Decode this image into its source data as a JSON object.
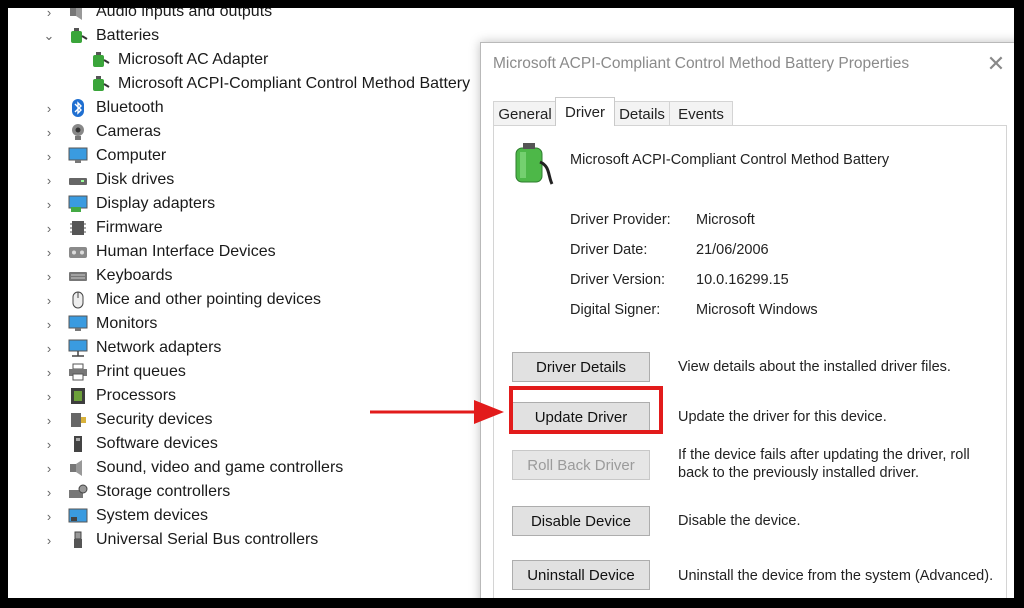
{
  "tree": [
    {
      "label": "Audio inputs and outputs",
      "expanded": false,
      "icon": "speaker-icon"
    },
    {
      "label": "Batteries",
      "expanded": true,
      "icon": "battery-icon"
    },
    {
      "label": "Microsoft AC Adapter",
      "child": true,
      "icon": "battery-icon"
    },
    {
      "label": "Microsoft ACPI-Compliant Control Method Battery",
      "child": true,
      "icon": "battery-icon"
    },
    {
      "label": "Bluetooth",
      "expanded": false,
      "icon": "bluetooth-icon"
    },
    {
      "label": "Cameras",
      "expanded": false,
      "icon": "camera-icon"
    },
    {
      "label": "Computer",
      "expanded": false,
      "icon": "monitor-icon"
    },
    {
      "label": "Disk drives",
      "expanded": false,
      "icon": "disk-drive-icon"
    },
    {
      "label": "Display adapters",
      "expanded": false,
      "icon": "display-adapter-icon"
    },
    {
      "label": "Firmware",
      "expanded": false,
      "icon": "chip-icon"
    },
    {
      "label": "Human Interface Devices",
      "expanded": false,
      "icon": "hid-icon"
    },
    {
      "label": "Keyboards",
      "expanded": false,
      "icon": "keyboard-icon"
    },
    {
      "label": "Mice and other pointing devices",
      "expanded": false,
      "icon": "mouse-icon"
    },
    {
      "label": "Monitors",
      "expanded": false,
      "icon": "monitor-icon"
    },
    {
      "label": "Network adapters",
      "expanded": false,
      "icon": "network-icon"
    },
    {
      "label": "Print queues",
      "expanded": false,
      "icon": "printer-icon"
    },
    {
      "label": "Processors",
      "expanded": false,
      "icon": "processor-icon"
    },
    {
      "label": "Security devices",
      "expanded": false,
      "icon": "security-device-icon"
    },
    {
      "label": "Software devices",
      "expanded": false,
      "icon": "software-device-icon"
    },
    {
      "label": "Sound, video and game controllers",
      "expanded": false,
      "icon": "speaker-icon"
    },
    {
      "label": "Storage controllers",
      "expanded": false,
      "icon": "storage-controller-icon"
    },
    {
      "label": "System devices",
      "expanded": false,
      "icon": "system-device-icon"
    },
    {
      "label": "Universal Serial Bus controllers",
      "expanded": false,
      "icon": "usb-icon"
    }
  ],
  "dialog": {
    "title": "Microsoft ACPI-Compliant Control Method Battery Properties",
    "close": "✕",
    "tabs": [
      "General",
      "Driver",
      "Details",
      "Events"
    ],
    "active_tab": "Driver",
    "device_name": "Microsoft ACPI-Compliant Control Method Battery",
    "properties": [
      {
        "label": "Driver Provider:",
        "value": "Microsoft"
      },
      {
        "label": "Driver Date:",
        "value": "21/06/2006"
      },
      {
        "label": "Driver Version:",
        "value": "10.0.16299.15"
      },
      {
        "label": "Digital Signer:",
        "value": "Microsoft Windows"
      }
    ],
    "actions": [
      {
        "button": "Driver Details",
        "desc": "View details about the installed driver files.",
        "disabled": false
      },
      {
        "button": "Update Driver",
        "desc": "Update the driver for this device.",
        "disabled": false,
        "highlighted": true
      },
      {
        "button": "Roll Back Driver",
        "desc": "If the device fails after updating the driver, roll back to the previously installed driver.",
        "disabled": true
      },
      {
        "button": "Disable Device",
        "desc": "Disable the device.",
        "disabled": false
      },
      {
        "button": "Uninstall Device",
        "desc": "Uninstall the device from the system (Advanced).",
        "disabled": false
      }
    ]
  },
  "annotation": {
    "highlight_color": "#e21b1b",
    "arrow_color": "#e21b1b"
  }
}
